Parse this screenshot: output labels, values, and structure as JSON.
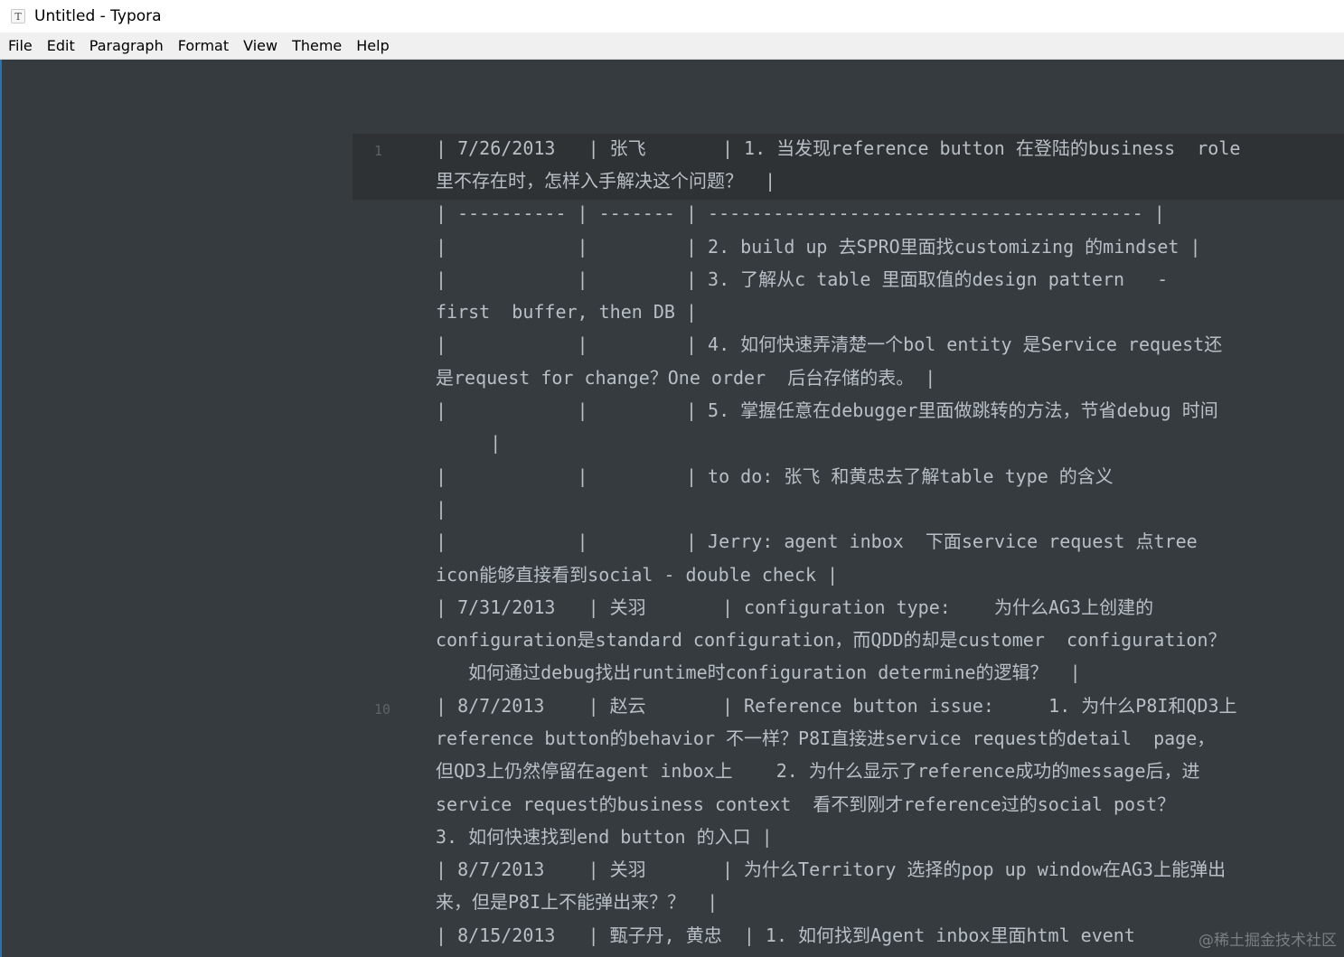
{
  "window": {
    "title": "Untitled - Typora",
    "icon": "typora-app-icon",
    "icon_glyph": "T"
  },
  "menu": [
    "File",
    "Edit",
    "Paragraph",
    "Format",
    "View",
    "Theme",
    "Help"
  ],
  "gutter": [
    "1",
    "10"
  ],
  "lines": [
    "| 7/26/2013   | 张飞       | 1. 当发现reference button 在登陆的business  role",
    "里不存在时，怎样入手解决这个问题？  |",
    "| ---------- | ------- | ---------------------------------------- |",
    "|            |         | 2. build up 去SPRO里面找customizing 的mindset |",
    "|            |         | 3. 了解从c table 里面取值的design pattern   -",
    "first  buffer, then DB |",
    "|            |         | 4. 如何快速弄清楚一个bol entity 是Service request还",
    "是request for change？One order  后台存储的表。 |",
    "|            |         | 5. 掌握任意在debugger里面做跳转的方法，节省debug 时间",
    "     |",
    "|            |         | to do: 张飞 和黄忠去了解table type 的含义",
    "|",
    "|            |         | Jerry: agent inbox  下面service request 点tree",
    "icon能够直接看到social - double check |",
    "| 7/31/2013   | 关羽       | configuration type:    为什么AG3上创建的",
    "configuration是standard configuration，而QDD的却是customer  configuration？",
    "   如何通过debug找出runtime时configuration determine的逻辑？  |",
    "| 8/7/2013    | 赵云       | Reference button issue:     1. 为什么P8I和QD3上",
    "reference button的behavior 不一样？P8I直接进service request的detail  page，",
    "但QD3上仍然停留在agent inbox上    2. 为什么显示了reference成功的message后，进",
    "service request的business context  看不到刚才reference过的social post？",
    "3. 如何快速找到end button 的入口 |",
    "| 8/7/2013    | 关羽       | 为什么Territory 选择的pop up window在AG3上能弹出",
    "来，但是P8I上不能弹出来？？  |",
    "| 8/15/2013   | 甄子丹, 黄忠  | 1. 如何找到Agent inbox里面html event"
  ],
  "watermark": "@稀土掘金技术社区"
}
